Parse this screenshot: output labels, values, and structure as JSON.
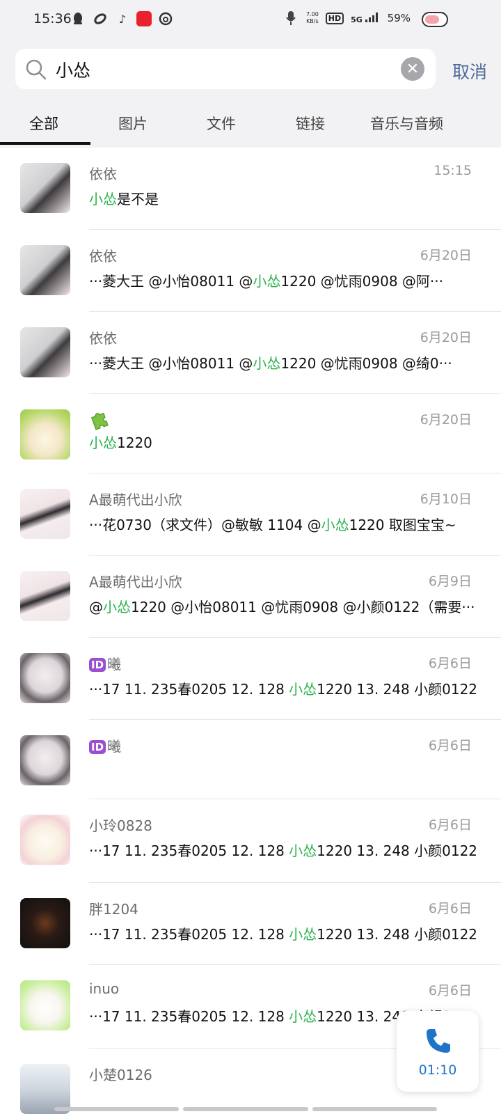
{
  "status_bar": {
    "time": "15:36",
    "speed_top": "7.00",
    "speed_unit": "KB/s",
    "hd": "HD",
    "network": "5G",
    "battery": "59%"
  },
  "search": {
    "query": "小怂",
    "cancel_label": "取消"
  },
  "tabs": [
    {
      "label": "全部"
    },
    {
      "label": "图片"
    },
    {
      "label": "文件"
    },
    {
      "label": "链接"
    },
    {
      "label": "音乐与音频"
    }
  ],
  "results": [
    {
      "name": "依依",
      "date": "15:15",
      "msg_pre": "",
      "msg_hl": "小怂",
      "msg_post": "是不是"
    },
    {
      "name": "依依",
      "date": "6月20日",
      "msg_pre": "···菱大王 @小怡08011 @",
      "msg_hl": "小怂",
      "msg_post": "1220 @忧雨0908 @阿···"
    },
    {
      "name": "依依",
      "date": "6月20日",
      "msg_pre": "···菱大王 @小怡08011 @",
      "msg_hl": "小怂",
      "msg_post": "1220 @忧雨0908 @绮0···"
    },
    {
      "name": "",
      "date": "6月20日",
      "msg_pre": "",
      "msg_hl": "小怂",
      "msg_post": "1220"
    },
    {
      "name": "A最萌代出小欣",
      "date": "6月10日",
      "msg_pre": "···花0730（求文件）@敏敏 1104 @",
      "msg_hl": "小怂",
      "msg_post": "1220 取图宝宝~"
    },
    {
      "name": "A最萌代出小欣",
      "date": "6月9日",
      "msg_pre": "@",
      "msg_hl": "小怂",
      "msg_post": "1220 @小怡08011 @忧雨0908 @小颜0122（需要···"
    },
    {
      "name": "曦",
      "date": "6月6日",
      "msg_pre": "···17 11. 235春0205 12. 128 ",
      "msg_hl": "小怂",
      "msg_post": "1220 13. 248 小颜0122（···"
    },
    {
      "name": "曦",
      "date": "6月6日",
      "msg_pre": "",
      "msg_hl": "",
      "msg_post": ""
    },
    {
      "name": "小玲0828",
      "date": "6月6日",
      "msg_pre": "···17 11. 235春0205 12. 128 ",
      "msg_hl": "小怂",
      "msg_post": "1220 13. 248 小颜0122（···"
    },
    {
      "name": "胖1204",
      "date": "6月6日",
      "msg_pre": "···17 11. 235春0205 12. 128 ",
      "msg_hl": "小怂",
      "msg_post": "1220 13. 248 小颜0122（···"
    },
    {
      "name": "inuo",
      "date": "6月6日",
      "msg_pre": "···17 11. 235春0205 12. 128 ",
      "msg_hl": "小怂",
      "msg_post": "1220 13. 248 小颜01"
    },
    {
      "name": "小楚0126",
      "date": "",
      "msg_pre": "",
      "msg_hl": "",
      "msg_post": ""
    }
  ],
  "call": {
    "timer": "01:10"
  },
  "colors": {
    "highlight": "#2bb24c",
    "cancel": "#4f6b9b",
    "call_timer": "#1e74c8"
  }
}
